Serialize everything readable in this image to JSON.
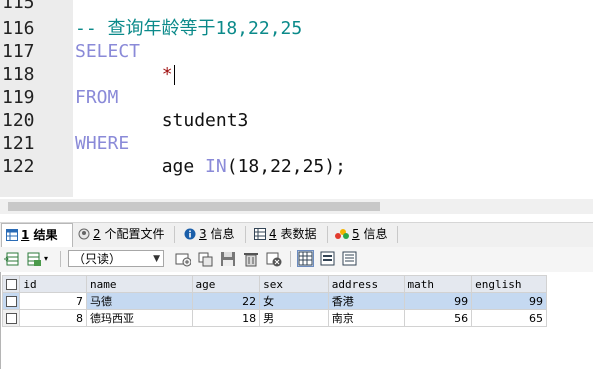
{
  "editor": {
    "lines": [
      {
        "num": "115",
        "tokens": []
      },
      {
        "num": "116",
        "tokens": [
          {
            "t": "-- 查询年龄等于18,22,25",
            "c": "comment"
          }
        ]
      },
      {
        "num": "117",
        "tokens": [
          {
            "t": "SELECT",
            "c": "kw"
          }
        ]
      },
      {
        "num": "118",
        "tokens": [
          {
            "t": "        ",
            "c": "plain"
          },
          {
            "t": "*",
            "c": "str"
          }
        ],
        "caret": true
      },
      {
        "num": "119",
        "tokens": [
          {
            "t": "FROM",
            "c": "kw"
          }
        ]
      },
      {
        "num": "120",
        "tokens": [
          {
            "t": "        student3",
            "c": "plain"
          }
        ]
      },
      {
        "num": "121",
        "tokens": [
          {
            "t": "WHERE",
            "c": "kw"
          }
        ]
      },
      {
        "num": "122",
        "tokens": [
          {
            "t": "        age ",
            "c": "plain"
          },
          {
            "t": "IN",
            "c": "kw"
          },
          {
            "t": "(18,22,25);",
            "c": "plain"
          }
        ]
      }
    ]
  },
  "tabs": [
    {
      "num": "1",
      "label": "结果",
      "icon": "table-result-icon",
      "active": true
    },
    {
      "num": "2",
      "label": "个配置文件",
      "icon": "profile-icon"
    },
    {
      "num": "3",
      "label": "信息",
      "icon": "info-icon"
    },
    {
      "num": "4",
      "label": "表数据",
      "icon": "table-data-icon"
    },
    {
      "num": "5",
      "label": "信息",
      "icon": "info-multi-icon"
    }
  ],
  "toolbar": {
    "mode_select": "（只读）"
  },
  "grid": {
    "columns": [
      "id",
      "name",
      "age",
      "sex",
      "address",
      "math",
      "english"
    ],
    "rows": [
      [
        "7",
        "马德",
        "22",
        "女",
        "香港",
        "99",
        "99"
      ],
      [
        "8",
        "德玛西亚",
        "18",
        "男",
        "南京",
        "56",
        "65"
      ]
    ]
  }
}
